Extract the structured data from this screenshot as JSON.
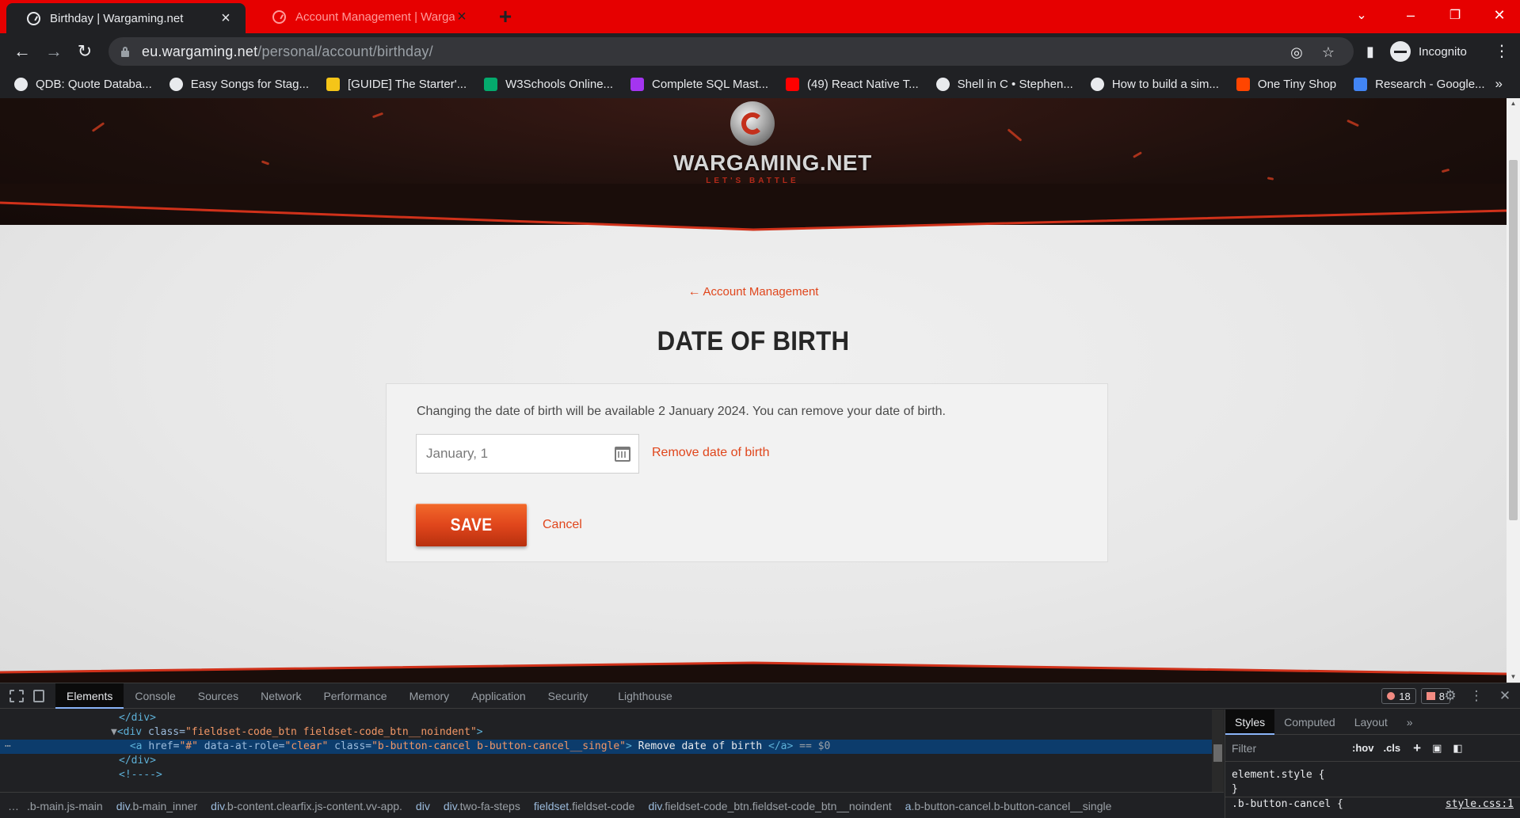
{
  "browser": {
    "tabs": [
      {
        "title": "Birthday | Wargaming.net",
        "active": true
      },
      {
        "title": "Account Management | Wargam",
        "active": false
      }
    ],
    "new_tab_label": "+",
    "window_controls": {
      "tab_search": "⌄",
      "minimize": "–",
      "restore": "❐",
      "close": "✕"
    },
    "url_host": "eu.wargaming.net",
    "url_path": "/personal/account/birthday/",
    "profile_label": "Incognito",
    "bookmarks": [
      {
        "label": "QDB: Quote Databa...",
        "icon": "globe-icon",
        "color": "#e8eaed"
      },
      {
        "label": "Easy Songs for Stag...",
        "icon": "hand-icon",
        "color": "#e8eaed"
      },
      {
        "label": "[GUIDE] The Starter'...",
        "icon": "ba-icon",
        "color": "#f5c518"
      },
      {
        "label": "W3Schools Online...",
        "icon": "w3-icon",
        "color": "#04aa6d"
      },
      {
        "label": "Complete SQL Mast...",
        "icon": "sql-icon",
        "color": "#a435f0"
      },
      {
        "label": "(49) React Native T...",
        "icon": "youtube-icon",
        "color": "#ff0000"
      },
      {
        "label": "Shell in C • Stephen...",
        "icon": "dots-icon",
        "color": "#e8eaed"
      },
      {
        "label": "How to build a sim...",
        "icon": "medium-icon",
        "color": "#e8eaed"
      },
      {
        "label": "One Tiny Shop",
        "icon": "one-icon",
        "color": "#ff4500"
      },
      {
        "label": "Research - Google...",
        "icon": "docs-icon",
        "color": "#4285f4"
      }
    ],
    "bookmarks_more": "»"
  },
  "page": {
    "logo_text": "WARGAMING.NET",
    "logo_tagline": "LET'S BATTLE",
    "back_link": "Account Management",
    "back_arrow": "←",
    "title": "DATE OF BIRTH",
    "notice": "Changing the date of birth will be available 2 January 2024. You can remove your date of birth.",
    "date_value": "January, 1",
    "remove_label": "Remove date of birth",
    "save_label": "SAVE",
    "cancel_label": "Cancel",
    "accent_color": "#e0461c"
  },
  "devtools": {
    "tabs": [
      "Elements",
      "Console",
      "Sources",
      "Network",
      "Performance",
      "Memory",
      "Application",
      "Security",
      "Lighthouse"
    ],
    "active_tab": "Elements",
    "error_count": "18",
    "issue_count": "8",
    "code": {
      "line1_close": "</div>",
      "line2_open": "<div ",
      "line2_attr": "class=",
      "line2_val": "\"fieldset-code_btn fieldset-code_btn__noindent\"",
      "line2_end": ">",
      "line3_open": "<a ",
      "line3_href_attr": "href=",
      "line3_href_val": "\"#\"",
      "line3_role_attr": " data-at-role=",
      "line3_role_val": "\"clear\"",
      "line3_class_attr": " class=",
      "line3_class_val": "\"b-button-cancel b-button-cancel__single\"",
      "line3_gt": ">",
      "line3_text": " Remove date of birth ",
      "line3_close": "</a>",
      "line3_ref": " == $0",
      "line4_close": "</div>",
      "line5_comment": "<!---->"
    },
    "breadcrumbs": [
      {
        "tag": "",
        "cls": ".b-main.js-main"
      },
      {
        "tag": "div",
        "cls": ".b-main_inner"
      },
      {
        "tag": "div",
        "cls": ".b-content.clearfix.js-content.vv-app."
      },
      {
        "tag": "div",
        "cls": ""
      },
      {
        "tag": "div",
        "cls": ".two-fa-steps"
      },
      {
        "tag": "fieldset",
        "cls": ".fieldset-code"
      },
      {
        "tag": "div",
        "cls": ".fieldset-code_btn.fieldset-code_btn__noindent"
      },
      {
        "tag": "a",
        "cls": ".b-button-cancel.b-button-cancel__single"
      }
    ],
    "styles_tabs": [
      "Styles",
      "Computed",
      "Layout"
    ],
    "styles_more": "»",
    "filter_placeholder": "Filter",
    "hov_label": ":hov",
    "cls_label": ".cls",
    "rule1": "element.style {",
    "rule1_close": "}",
    "rule2": ".b-button-cancel {",
    "rule2_source": "style.css:1"
  }
}
